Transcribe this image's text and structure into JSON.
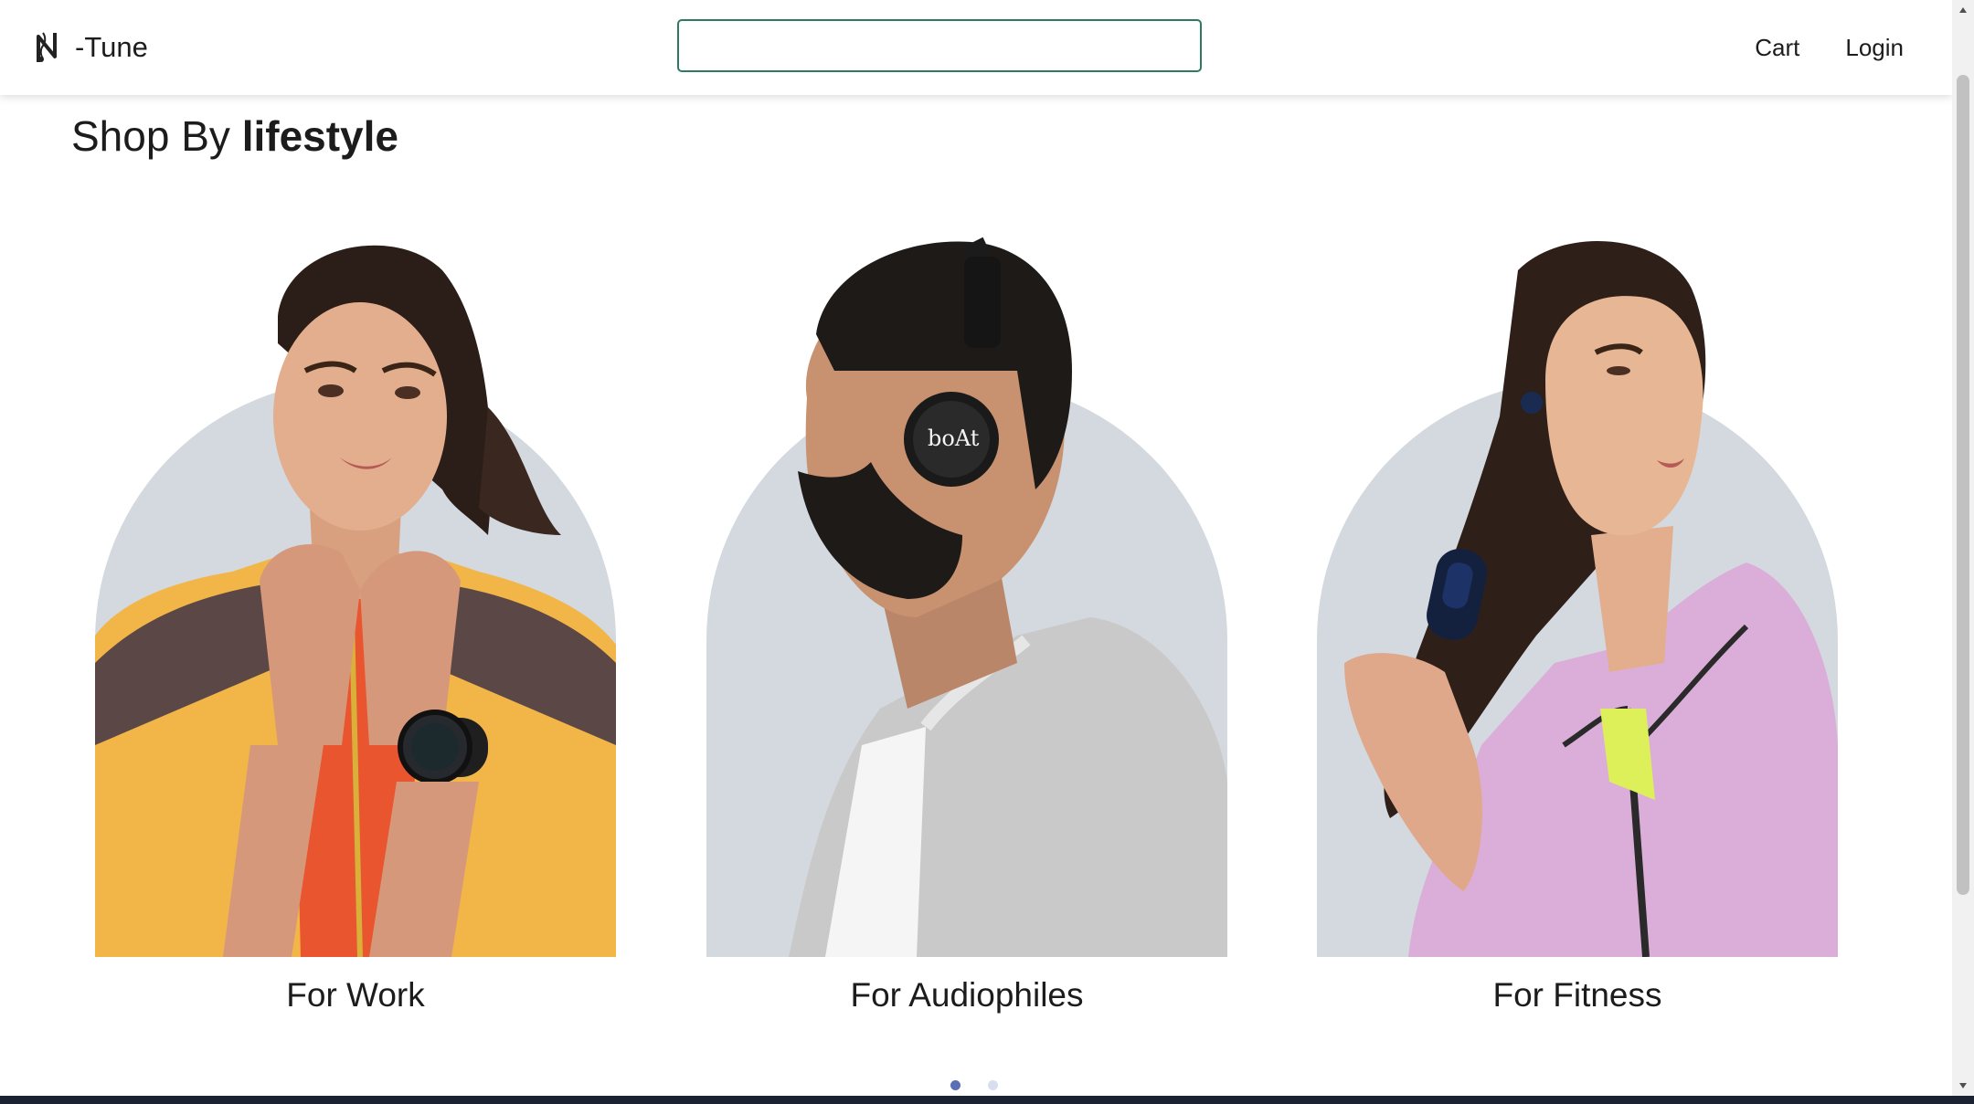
{
  "header": {
    "brand_name": "-Tune",
    "search_value": "",
    "nav": [
      {
        "label": "Cart"
      },
      {
        "label": "Login"
      }
    ]
  },
  "section": {
    "title_prefix": "Shop By",
    "title_bold": "lifestyle"
  },
  "cards": [
    {
      "label": "For Work"
    },
    {
      "label": "For Audiophiles"
    },
    {
      "label": "For Fitness"
    }
  ],
  "carousel": {
    "slide_count": 2,
    "active_slide": 1
  },
  "colors": {
    "search_border": "#2f7a64",
    "arch": "#d3d9de",
    "dot_active": "#5a6fb4",
    "dot_inactive": "#d8deef"
  }
}
